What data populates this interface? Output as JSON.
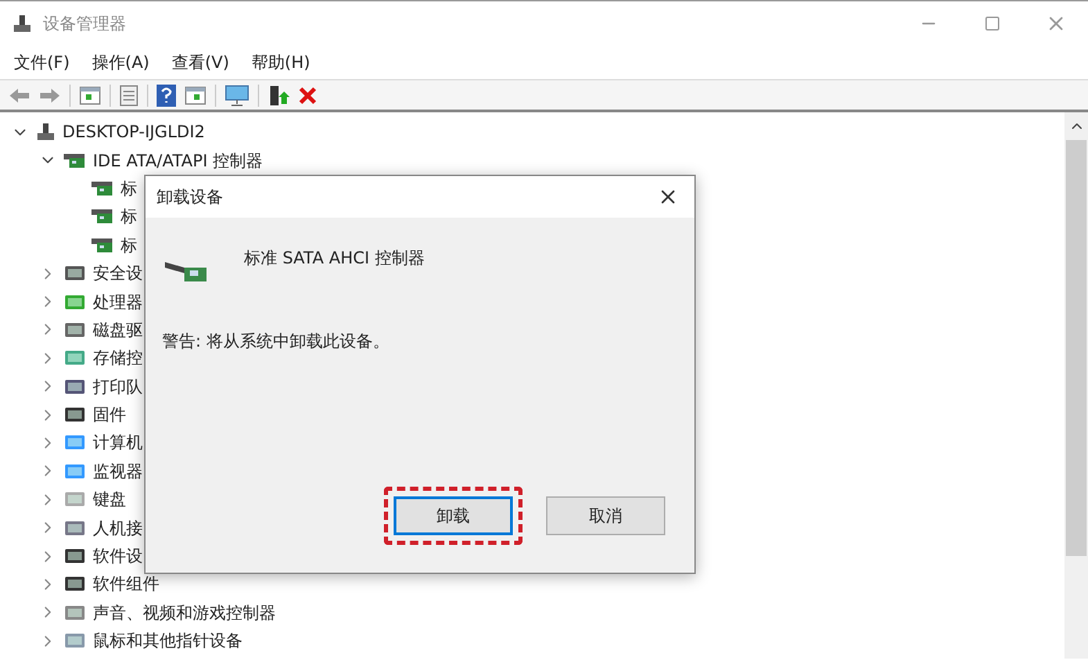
{
  "window": {
    "title": "设备管理器"
  },
  "menu": [
    "文件(F)",
    "操作(A)",
    "查看(V)",
    "帮助(H)"
  ],
  "tree": {
    "label": "DESKTOP-IJGLDI2",
    "expanded": true,
    "children": [
      {
        "label": "IDE ATA/ATAPI 控制器",
        "expanded": true,
        "children": [
          {
            "label": "标"
          },
          {
            "label": "标"
          },
          {
            "label": "标"
          }
        ]
      },
      {
        "label": "安全设",
        "expanded": false
      },
      {
        "label": "处理器",
        "expanded": false
      },
      {
        "label": "磁盘驱",
        "expanded": false
      },
      {
        "label": "存储控",
        "expanded": false
      },
      {
        "label": "打印队",
        "expanded": false
      },
      {
        "label": "固件",
        "expanded": false
      },
      {
        "label": "计算机",
        "expanded": false
      },
      {
        "label": "监视器",
        "expanded": false
      },
      {
        "label": "键盘",
        "expanded": false
      },
      {
        "label": "人机接",
        "expanded": false
      },
      {
        "label": "软件设",
        "expanded": false
      },
      {
        "label": "软件组件",
        "expanded": false
      },
      {
        "label": "声音、视频和游戏控制器",
        "expanded": false
      },
      {
        "label": "鼠标和其他指针设备",
        "expanded": false
      }
    ]
  },
  "dialog": {
    "title": "卸载设备",
    "device": "标准 SATA AHCI 控制器",
    "warning": "警告: 将从系统中卸载此设备。",
    "buttons": [
      {
        "label": "卸载",
        "focused": true,
        "highlighted": true
      },
      {
        "label": "取消",
        "focused": false,
        "highlighted": false
      }
    ]
  }
}
